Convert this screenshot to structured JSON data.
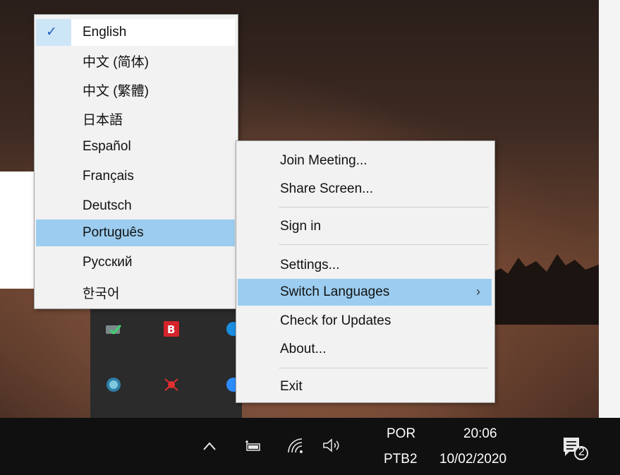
{
  "language_menu": {
    "items": [
      {
        "label": "English",
        "checked": true
      },
      {
        "label": "中文 (简体)"
      },
      {
        "label": "中文 (繁體)"
      },
      {
        "label": "日本語"
      },
      {
        "label": "Español"
      },
      {
        "label": "Français"
      },
      {
        "label": "Deutsch"
      },
      {
        "label": "Português",
        "highlighted": true
      },
      {
        "label": "Русский"
      },
      {
        "label": "한국어"
      }
    ],
    "check_glyph": "✓"
  },
  "context_menu": {
    "join_meeting": "Join Meeting...",
    "share_screen": "Share Screen...",
    "sign_in": "Sign in",
    "settings": "Settings...",
    "switch_languages": "Switch Languages",
    "submenu_arrow": "›",
    "check_updates": "Check for Updates",
    "about": "About...",
    "exit": "Exit"
  },
  "taskbar": {
    "language_top": "POR",
    "language_bottom": "PTB2",
    "time": "20:06",
    "date": "10/02/2020",
    "notification_count": "2"
  },
  "colors": {
    "highlight": "#9ccdf0",
    "menu_bg": "#f2f2f2",
    "taskbar_bg": "#101010"
  }
}
